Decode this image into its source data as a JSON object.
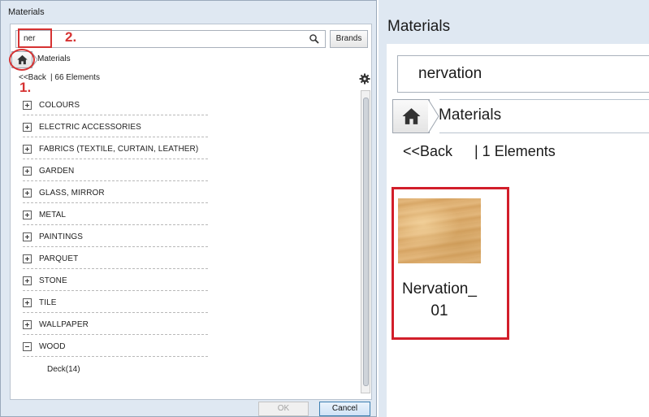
{
  "left_dialog": {
    "title": "Materials",
    "search_value": "ner",
    "brands_label": "Brands",
    "breadcrumb_label": "Materials",
    "back_label": "<<Back",
    "count_label": "| 66 Elements",
    "annotation_1": "1.",
    "annotation_2": "2.",
    "categories": [
      {
        "label": "COLOURS",
        "expanded": false
      },
      {
        "label": "ELECTRIC ACCESSORIES",
        "expanded": false
      },
      {
        "label": "FABRICS (TEXTILE, CURTAIN, LEATHER)",
        "expanded": false
      },
      {
        "label": "GARDEN",
        "expanded": false
      },
      {
        "label": "GLASS, MIRROR",
        "expanded": false
      },
      {
        "label": "METAL",
        "expanded": false
      },
      {
        "label": "PAINTINGS",
        "expanded": false
      },
      {
        "label": "PARQUET",
        "expanded": false
      },
      {
        "label": "STONE",
        "expanded": false
      },
      {
        "label": "TILE",
        "expanded": false
      },
      {
        "label": "WALLPAPER",
        "expanded": false
      },
      {
        "label": "WOOD",
        "expanded": true
      }
    ],
    "subitem_label": "Deck(14)",
    "ok_label": "OK",
    "cancel_label": "Cancel"
  },
  "right_panel": {
    "title": "Materials",
    "search_value": "nervation",
    "breadcrumb_label": "Materials",
    "back_label": "<<Back",
    "count_label": "| 1 Elements",
    "item_label": "Nervation_\n01"
  },
  "colors": {
    "annotation_red": "#d63232",
    "window_bg": "#dfe8f2",
    "cancel_border": "#3c7fb1"
  },
  "icons": [
    "search-icon",
    "home-icon",
    "gear-icon",
    "plus-box-icon",
    "minus-box-icon"
  ]
}
